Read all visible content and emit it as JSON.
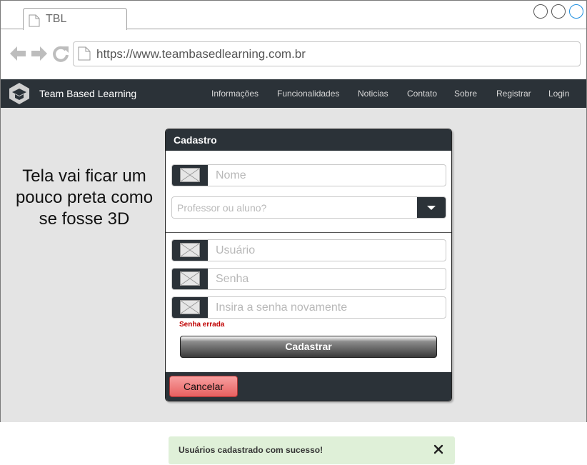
{
  "browser": {
    "tab_title": "TBL",
    "url": "https://www.teambasedlearning.com.br"
  },
  "navbar": {
    "brand": "Team Based Learning",
    "links": [
      "Informações",
      "Funcionalidades",
      "Noticias",
      "Contato",
      "Sobre",
      "Registrar",
      "Login"
    ]
  },
  "note": "Tela vai ficar um pouco preta como se fosse 3D",
  "modal": {
    "title": "Cadastro",
    "name_placeholder": "Nome",
    "role_placeholder": "Professor ou aluno?",
    "user_placeholder": "Usuário",
    "password_placeholder": "Senha",
    "confirm_placeholder": "Insira a senha novamente",
    "error": "Senha errada",
    "submit_label": "Cadastrar",
    "cancel_label": "Cancelar"
  },
  "toast": {
    "message": "Usuários cadastrado com sucesso!"
  },
  "colors": {
    "navbar": "#2b3238",
    "overlay": "#e4e4e4",
    "error": "#c00000",
    "toast_bg": "#dff0d8",
    "cancel": "#e86060"
  }
}
